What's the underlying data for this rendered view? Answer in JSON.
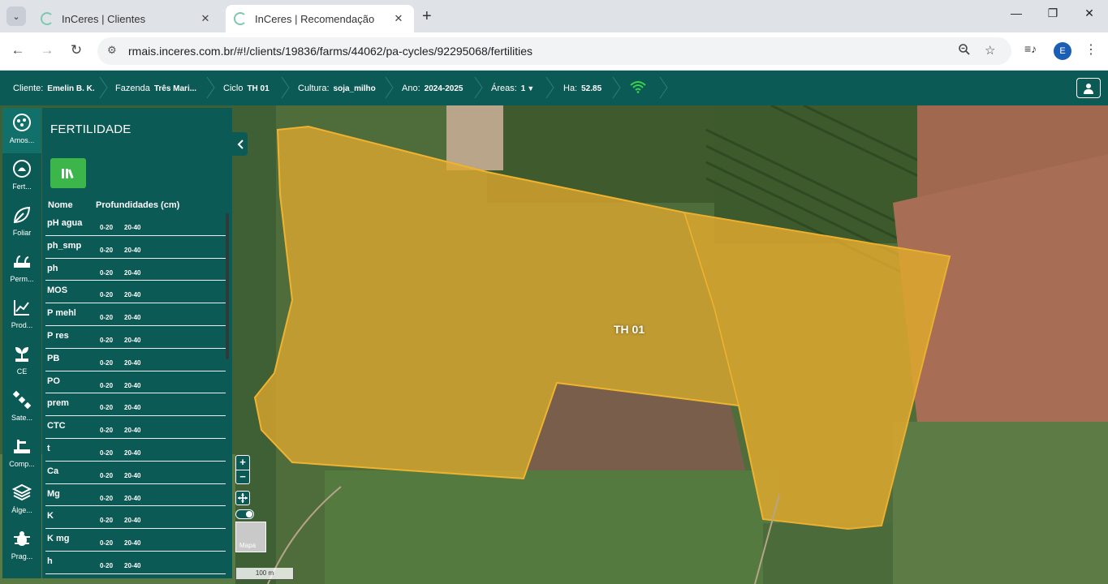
{
  "browser": {
    "tabs": [
      {
        "title": "InCeres | Clientes",
        "active": false
      },
      {
        "title": "InCeres | Recomendação",
        "active": true
      }
    ],
    "url": "rmais.inceres.com.br/#!/clients/19836/farms/44062/pa-cycles/92295068/fertilities",
    "profile_initial": "E"
  },
  "header": {
    "crumbs": [
      {
        "label": "Cliente:",
        "value": "Emelin B. K."
      },
      {
        "label": "Fazenda",
        "value": "Três Mari..."
      },
      {
        "label": "Ciclo",
        "value": "TH 01"
      },
      {
        "label": "Cultura:",
        "value": "soja_milho"
      },
      {
        "label": "Ano:",
        "value": "2024-2025"
      },
      {
        "label": "Áreas:",
        "value": "1"
      },
      {
        "label": "Ha:",
        "value": "52.85"
      }
    ]
  },
  "rail": [
    {
      "label": "Amos...",
      "icon": "samples-icon"
    },
    {
      "label": "Fert...",
      "icon": "fertility-icon"
    },
    {
      "label": "Foliar",
      "icon": "leaf-icon"
    },
    {
      "label": "Perm...",
      "icon": "permission-icon"
    },
    {
      "label": "Prod...",
      "icon": "chart-line-icon"
    },
    {
      "label": "CE",
      "icon": "plant-icon"
    },
    {
      "label": "Sate...",
      "icon": "satellite-icon"
    },
    {
      "label": "Comp...",
      "icon": "compaction-icon"
    },
    {
      "label": "Álge...",
      "icon": "layers-icon"
    },
    {
      "label": "Prag...",
      "icon": "bug-icon"
    }
  ],
  "panel": {
    "title": "FERTILIDADE",
    "col_name": "Nome",
    "col_depths": "Profundidades (cm)",
    "rows": [
      {
        "name": "pH agua",
        "d1": "0-20",
        "d2": "20-40"
      },
      {
        "name": "ph_smp",
        "d1": "0-20",
        "d2": "20-40"
      },
      {
        "name": "ph",
        "d1": "0-20",
        "d2": "20-40"
      },
      {
        "name": "MOS",
        "d1": "0-20",
        "d2": "20-40"
      },
      {
        "name": "P mehl",
        "d1": "0-20",
        "d2": "20-40"
      },
      {
        "name": "P res",
        "d1": "0-20",
        "d2": "20-40"
      },
      {
        "name": "PB",
        "d1": "0-20",
        "d2": "20-40"
      },
      {
        "name": "PO",
        "d1": "0-20",
        "d2": "20-40"
      },
      {
        "name": "prem",
        "d1": "0-20",
        "d2": "20-40"
      },
      {
        "name": "CTC",
        "d1": "0-20",
        "d2": "20-40"
      },
      {
        "name": "t",
        "d1": "0-20",
        "d2": "20-40"
      },
      {
        "name": "Ca",
        "d1": "0-20",
        "d2": "20-40"
      },
      {
        "name": "Mg",
        "d1": "0-20",
        "d2": "20-40"
      },
      {
        "name": "K",
        "d1": "0-20",
        "d2": "20-40"
      },
      {
        "name": "K mg",
        "d1": "0-20",
        "d2": "20-40"
      },
      {
        "name": "h",
        "d1": "0-20",
        "d2": "20-40"
      }
    ]
  },
  "map": {
    "field_label": "TH 01",
    "zoom_in": "+",
    "zoom_out": "−",
    "basemap_label": "Mapa",
    "scale_label": "100 m"
  },
  "colors": {
    "brand": "#0b5a55",
    "accent_green": "#3cb54a",
    "field_fill": "#e0a82e"
  }
}
